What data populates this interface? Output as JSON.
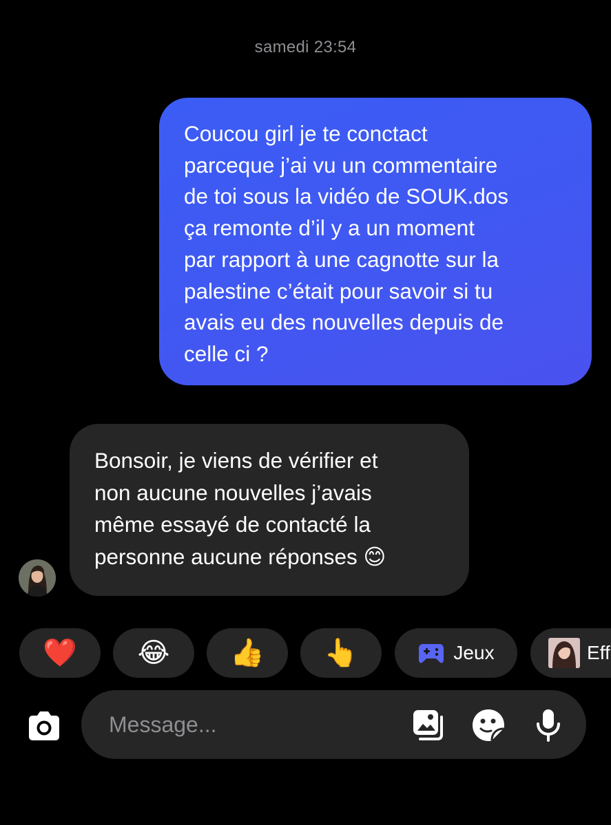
{
  "conversation": {
    "timestamp": "samedi 23:54",
    "messages": [
      {
        "direction": "outgoing",
        "text": "Coucou girl je te conctact\nparceque j’ai vu un commentaire\nde toi sous la vidéo de SOUK.dos\nça remonte d’il y a un moment\npar rapport à une cagnotte sur la\npalestine c’était pour savoir si tu\navais eu des nouvelles depuis de\ncelle ci ?"
      },
      {
        "direction": "incoming",
        "text": "Bonsoir, je viens de vérifier et\nnon aucune nouvelles j’avais\nmême essayé de contacté la\npersonne aucune réponses 😊"
      }
    ]
  },
  "quick_actions": [
    {
      "emoji": "❤️",
      "icon": "heart-emoji"
    },
    {
      "emoji": "😂",
      "icon": "tears-of-joy-emoji"
    },
    {
      "emoji": "👍",
      "icon": "thumbs-up-emoji"
    },
    {
      "emoji": "👆",
      "icon": "pointing-finger-emoji"
    },
    {
      "label": "Jeux",
      "icon": "gamepad-icon"
    },
    {
      "label": "Eff",
      "icon": "effects-thumbnail"
    }
  ],
  "composer": {
    "placeholder": "Message..."
  },
  "colors": {
    "background": "#000000",
    "outgoing_bubble": "#3f59f2",
    "incoming_bubble": "#262626",
    "timestamp": "#8e8e93",
    "games_icon": "#5865f2"
  }
}
